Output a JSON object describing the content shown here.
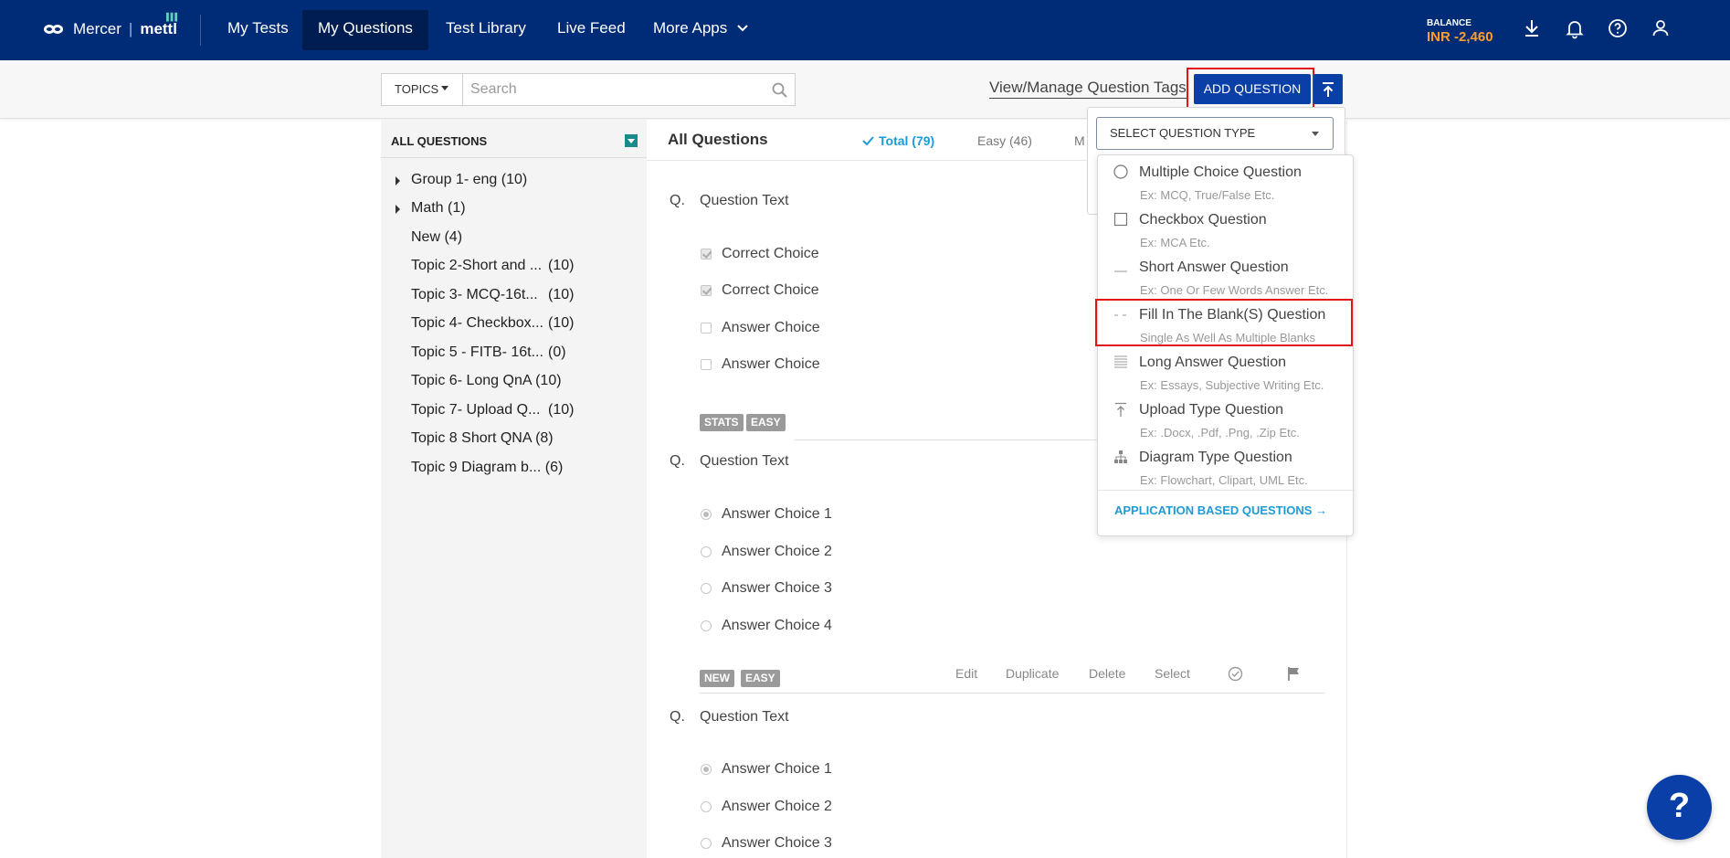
{
  "brand": {
    "name": "Mercer",
    "product": "mettl"
  },
  "nav": {
    "items": [
      {
        "label": "My Tests"
      },
      {
        "label": "My Questions"
      },
      {
        "label": "Test Library"
      },
      {
        "label": "Live Feed"
      },
      {
        "label": "More Apps"
      }
    ],
    "active": "My Questions"
  },
  "balance": {
    "label": "BALANCE",
    "value": "INR -2,460"
  },
  "toolbar": {
    "topics_label": "TOPICS",
    "search_placeholder": "Search",
    "manage_tags_label": "View/Manage Question Tags",
    "add_question_label": "ADD QUESTION"
  },
  "sidebar": {
    "title": "ALL QUESTIONS",
    "items": [
      {
        "label": "Group 1- eng",
        "count": "(10)"
      },
      {
        "label": "Math",
        "count": "(1)"
      },
      {
        "label": "New",
        "count": "(4)"
      },
      {
        "label": "Topic 2-Short and ...",
        "count": "(10)"
      },
      {
        "label": "Topic 3- MCQ-16t...",
        "count": "(10)"
      },
      {
        "label": "Topic 4- Checkbox...",
        "count": "(10)"
      },
      {
        "label": "Topic 5 - FITB- 16t...",
        "count": "(0)"
      },
      {
        "label": "Topic 6- Long QnA",
        "count": "(10)"
      },
      {
        "label": "Topic 7- Upload Q...",
        "count": "(10)"
      },
      {
        "label": "Topic 8 Short QNA",
        "count": "(8)"
      },
      {
        "label": "Topic 9 Diagram b...",
        "count": "(6)"
      }
    ]
  },
  "main": {
    "title": "All Questions",
    "filters": {
      "total": "Total (79)",
      "easy": "Easy (46)",
      "medium_partial": "M"
    },
    "q_prefix": "Q.",
    "questions": [
      {
        "text": "Question Text",
        "choices": [
          "Correct Choice",
          "Correct Choice",
          "Answer Choice",
          "Answer Choice"
        ],
        "tags": [
          "STATS",
          "EASY"
        ]
      },
      {
        "text": "Question Text",
        "choices": [
          "Answer Choice 1",
          "Answer Choice 2",
          "Answer Choice 3",
          "Answer Choice 4"
        ],
        "tags": [
          "NEW",
          "EASY"
        ]
      },
      {
        "text": "Question Text",
        "choices": [
          "Answer Choice 1",
          "Answer Choice 2",
          "Answer Choice 3"
        ]
      }
    ],
    "actions": {
      "edit": "Edit",
      "duplicate": "Duplicate",
      "delete": "Delete",
      "select": "Select"
    }
  },
  "question_type_dropdown": {
    "select_label": "SELECT QUESTION TYPE",
    "options": [
      {
        "title": "Multiple Choice Question",
        "example": "Ex: MCQ, True/False Etc.",
        "icon": "radio-icon"
      },
      {
        "title": "Checkbox Question",
        "example": "Ex: MCA Etc.",
        "icon": "checkbox-icon"
      },
      {
        "title": "Short Answer Question",
        "example": "Ex: One Or Few Words Answer Etc.",
        "icon": "short-line-icon"
      },
      {
        "title": "Fill In The Blank(S) Question",
        "example": "Single As Well As Multiple Blanks",
        "icon": "dashes-icon"
      },
      {
        "title": "Long Answer Question",
        "example": "Ex: Essays, Subjective Writing Etc.",
        "icon": "lines-icon"
      },
      {
        "title": "Upload Type Question",
        "example": "Ex: .Docx, .Pdf, .Png, .Zip Etc.",
        "icon": "upload-icon"
      },
      {
        "title": "Diagram Type Question",
        "example": "Ex: Flowchart, Clipart, UML Etc.",
        "icon": "diagram-icon"
      }
    ],
    "application_based_label": "APPLICATION BASED QUESTIONS →"
  },
  "help_label": "?",
  "colors": {
    "nav_bg": "#002c77",
    "accent": "#0a3fa8",
    "balance": "#ff9e2b",
    "highlight": "#e3151a",
    "link": "#1e9bd7"
  }
}
